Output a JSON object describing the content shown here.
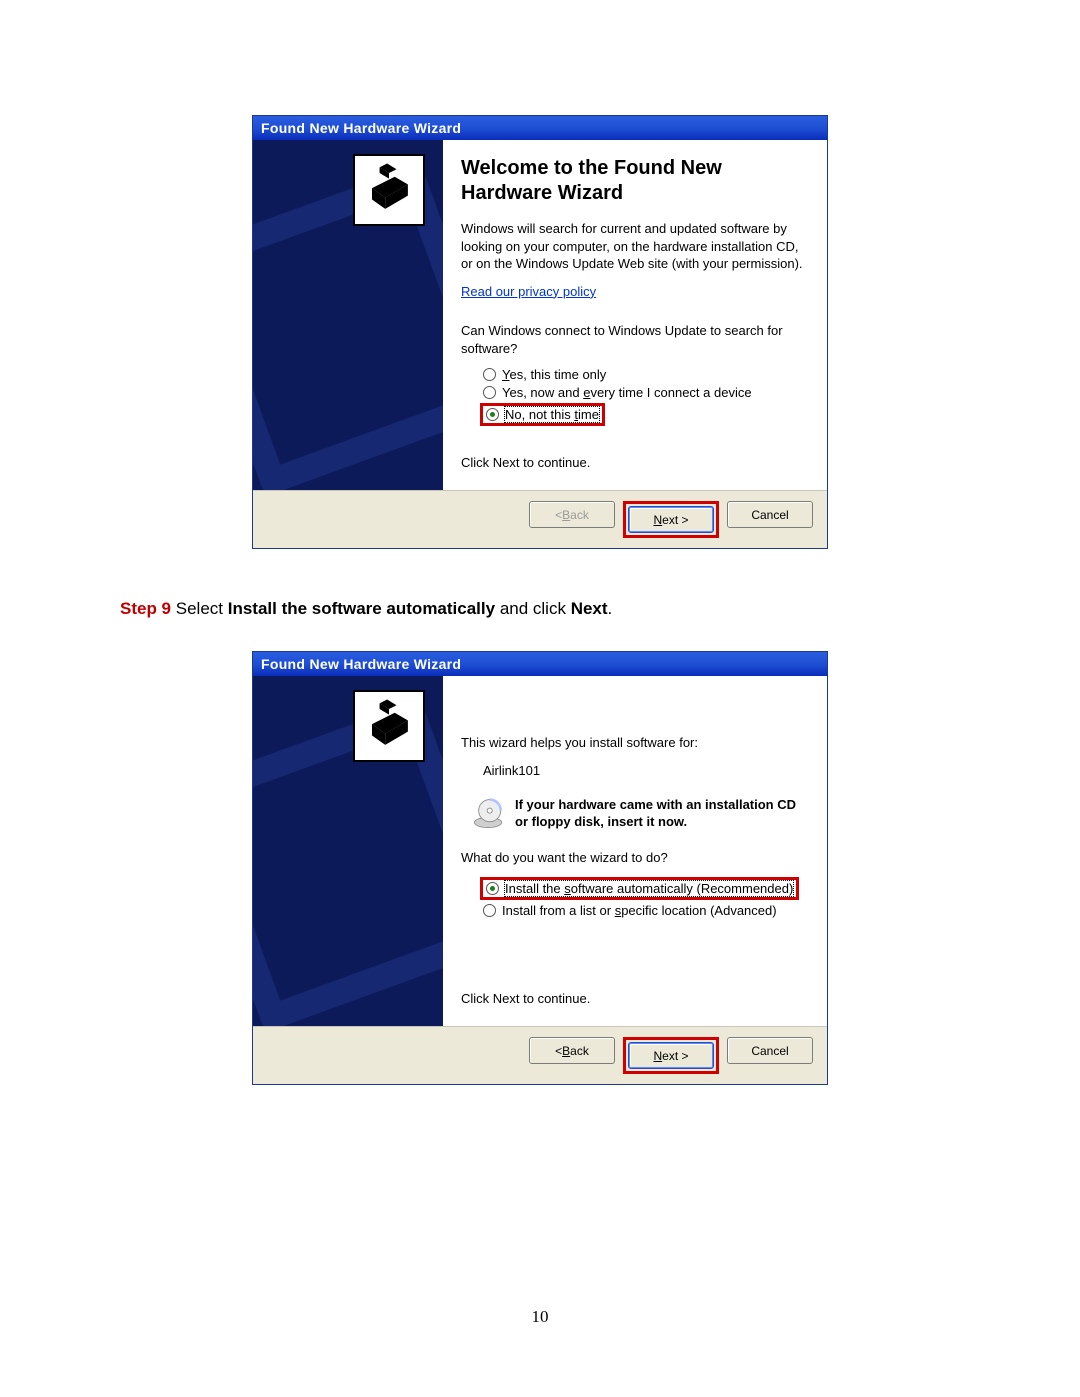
{
  "wiz1": {
    "title": "Found New Hardware Wizard",
    "heading": "Welcome to the Found New Hardware Wizard",
    "intro": "Windows will search for current and updated software by looking on your computer, on the hardware installation CD, or on the Windows Update Web site (with your permission).",
    "privacy_link": "Read our privacy policy",
    "question": "Can Windows connect to Windows Update to search for software?",
    "opt1_pre": "",
    "opt1_u": "Y",
    "opt1_post": "es, this time only",
    "opt2_pre": "Yes, now and ",
    "opt2_u": "e",
    "opt2_post": "very time I connect a device",
    "opt3_pre": "No, not this ",
    "opt3_u": "t",
    "opt3_post": "ime",
    "continue": "Click Next to continue.",
    "back_pre": "< ",
    "back_u": "B",
    "back_post": "ack",
    "next_u": "N",
    "next_post": "ext >",
    "cancel": "Cancel"
  },
  "step": {
    "label": "Step 9",
    "t1": " Select ",
    "bold1": "Install the software automatically",
    "t2": " and click ",
    "bold2": "Next",
    "t3": "."
  },
  "wiz2": {
    "title": "Found New Hardware Wizard",
    "intro": "This wizard helps you install software for:",
    "device": "Airlink101",
    "cd_text": "If your hardware came with an installation CD or floppy disk, insert it now.",
    "question": "What do you want the wizard to do?",
    "opt1_pre": "Install the ",
    "opt1_u": "s",
    "opt1_post": "oftware automatically (Recommended)",
    "opt2_pre": "Install from a list or ",
    "opt2_u": "s",
    "opt2_post": "pecific location (Advanced)",
    "continue": "Click Next to continue.",
    "back_pre": "< ",
    "back_u": "B",
    "back_post": "ack",
    "next_u": "N",
    "next_post": "ext >",
    "cancel": "Cancel"
  },
  "page_number": "10"
}
